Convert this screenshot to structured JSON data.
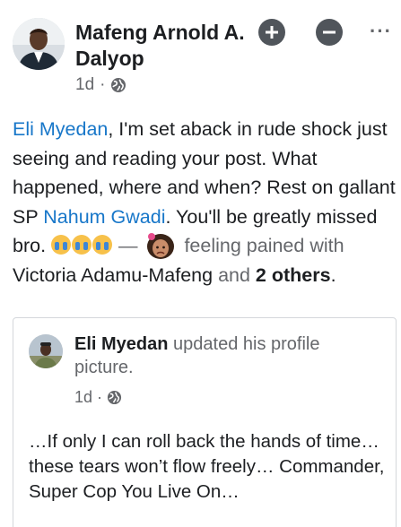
{
  "post": {
    "author": "Mafeng Arnold A. Dalyop",
    "time": "1d",
    "separator": "·",
    "privacy_icon": "globe-icon",
    "actions": {
      "follow_icon": "plus-circle-icon",
      "remove_icon": "minus-circle-icon",
      "more_label": "···"
    },
    "text": {
      "mention1": "Eli Myedan",
      "part1": ", I'm set aback in rude shock just seeing and reading your post. What happened, where and when? Rest on gallant SP ",
      "mention2": "Nahum Gwadi",
      "part2": ". You'll be greatly missed bro. ",
      "dash": " — ",
      "feeling": " feeling pained with ",
      "tagged": "Victoria Adamu-Mafeng",
      "and": " and ",
      "others": "2 others",
      "end": "."
    },
    "emojis": [
      "crying-emoji",
      "crying-emoji",
      "crying-emoji",
      "pained-face-emoji"
    ]
  },
  "shared": {
    "author": "Eli Myedan",
    "action": " updated his profile picture.",
    "time": "1d",
    "separator": "·",
    "privacy_icon": "globe-icon",
    "text": "…If only I can roll back the hands of time…these tears won’t flow freely… Commander, Super Cop You Live  On…"
  },
  "colors": {
    "link": "#1877c9",
    "secondary_text": "#65676b",
    "primary_text": "#1c1e21",
    "action_button": "#50555b"
  }
}
